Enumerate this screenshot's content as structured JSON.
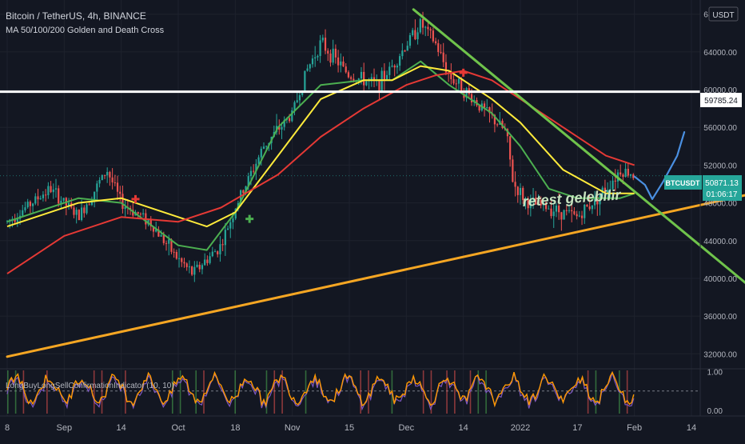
{
  "header": {
    "title": "Bitcoin / TetherUS, 4h, BINANCE",
    "indicator": "MA 50/100/200 Golden and Death Cross"
  },
  "currency_badge": "USDT",
  "annotation": "retest gelebilir",
  "price_tag": {
    "symbol": "BTCUSDT",
    "price": "50871.13",
    "countdown": "01:06:17"
  },
  "level_tag": "59785.24",
  "oscillator": {
    "label": "LongBuyLongSellConfirmationIndicator (10, 10)"
  },
  "colors": {
    "background": "#131722",
    "candle_up": "#26a69a",
    "candle_down": "#ef5350",
    "ma50": "#4caf50",
    "ma100": "#ffeb3b",
    "ma200": "#e53935",
    "support": "#f5a623",
    "resistance": "#6fc34b",
    "horizontal": "#ffffff",
    "forecast": "#4a90e2"
  },
  "chart_data": [
    {
      "type": "line",
      "title": "Bitcoin / TetherUS, 4h, BINANCE",
      "x_labels": [
        "8",
        "Sep",
        "14",
        "Oct",
        "18",
        "Nov",
        "15",
        "Dec",
        "14",
        "2022",
        "17",
        "Feb",
        "14"
      ],
      "y_ticks": [
        "32000.00",
        "36000.00",
        "40000.00",
        "44000.00",
        "48000.00",
        "52000.00",
        "56000.00",
        "60000.00",
        "64000.00",
        "68000.00"
      ],
      "ylim": [
        30500,
        69500
      ],
      "price_path": [
        [
          0,
          46000
        ],
        [
          6,
          49500
        ],
        [
          10,
          46500
        ],
        [
          14,
          51500
        ],
        [
          16,
          48000
        ],
        [
          20,
          46000
        ],
        [
          24,
          42000
        ],
        [
          26,
          40500
        ],
        [
          30,
          43500
        ],
        [
          32,
          47500
        ],
        [
          36,
          54000
        ],
        [
          40,
          57500
        ],
        [
          42,
          62000
        ],
        [
          44,
          65000
        ],
        [
          48,
          61500
        ],
        [
          52,
          60500
        ],
        [
          54,
          62500
        ],
        [
          58,
          67000
        ],
        [
          60,
          65000
        ],
        [
          62,
          61500
        ],
        [
          66,
          58500
        ],
        [
          68,
          57000
        ],
        [
          70,
          55500
        ],
        [
          71,
          50000
        ],
        [
          73,
          48000
        ],
        [
          76,
          47500
        ],
        [
          80,
          46500
        ],
        [
          84,
          49500
        ],
        [
          86,
          51500
        ],
        [
          88,
          51000
        ]
      ],
      "series": [
        {
          "name": "MA 50",
          "values": [
            [
              0,
              46000
            ],
            [
              10,
              48500
            ],
            [
              16,
              48000
            ],
            [
              24,
              43500
            ],
            [
              28,
              43000
            ],
            [
              32,
              47000
            ],
            [
              38,
              56000
            ],
            [
              44,
              60500
            ],
            [
              50,
              61000
            ],
            [
              54,
              61000
            ],
            [
              58,
              63000
            ],
            [
              62,
              60500
            ],
            [
              68,
              57500
            ],
            [
              72,
              54000
            ],
            [
              76,
              49500
            ],
            [
              80,
              48500
            ],
            [
              86,
              48500
            ],
            [
              88,
              49000
            ]
          ]
        },
        {
          "name": "MA 100",
          "values": [
            [
              0,
              45500
            ],
            [
              10,
              48000
            ],
            [
              16,
              48500
            ],
            [
              24,
              46500
            ],
            [
              28,
              45500
            ],
            [
              32,
              47000
            ],
            [
              38,
              53000
            ],
            [
              44,
              59000
            ],
            [
              50,
              61000
            ],
            [
              54,
              61000
            ],
            [
              58,
              62500
            ],
            [
              62,
              62000
            ],
            [
              68,
              59000
            ],
            [
              72,
              56500
            ],
            [
              78,
              51500
            ],
            [
              84,
              49000
            ],
            [
              88,
              49000
            ]
          ]
        },
        {
          "name": "MA 200",
          "values": [
            [
              0,
              40500
            ],
            [
              8,
              44500
            ],
            [
              16,
              46500
            ],
            [
              24,
              46000
            ],
            [
              30,
              47500
            ],
            [
              38,
              51000
            ],
            [
              44,
              55000
            ],
            [
              50,
              58000
            ],
            [
              56,
              60500
            ],
            [
              60,
              61500
            ],
            [
              64,
              62000
            ],
            [
              68,
              61000
            ],
            [
              72,
              59000
            ],
            [
              78,
              56000
            ],
            [
              84,
              53000
            ],
            [
              88,
              52000
            ]
          ]
        }
      ],
      "trendlines": [
        {
          "name": "ascending support",
          "from": [
            0,
            31700
          ],
          "to": [
            118,
            51200
          ]
        },
        {
          "name": "descending resistance",
          "from": [
            57,
            68500
          ],
          "to": [
            116,
            31800
          ]
        },
        {
          "name": "horizontal level",
          "value": 59785.24
        }
      ],
      "forecast": [
        [
          88,
          50800
        ],
        [
          89.5,
          49900
        ],
        [
          90.5,
          48400
        ],
        [
          92,
          50200
        ],
        [
          94,
          53000
        ],
        [
          95,
          55500
        ]
      ],
      "markers": [
        {
          "x": 18,
          "y": 48400,
          "type": "death cross"
        },
        {
          "x": 34,
          "y": 46300,
          "type": "golden cross"
        },
        {
          "x": 64,
          "y": 61800,
          "type": "death cross"
        }
      ]
    },
    {
      "type": "line",
      "title": "LongBuyLongSellConfirmationIndicator (10, 10)",
      "y_ticks": [
        "1.00",
        "0.00"
      ],
      "ylim": [
        -0.1,
        1.05
      ],
      "reference_level": 0.5
    }
  ]
}
